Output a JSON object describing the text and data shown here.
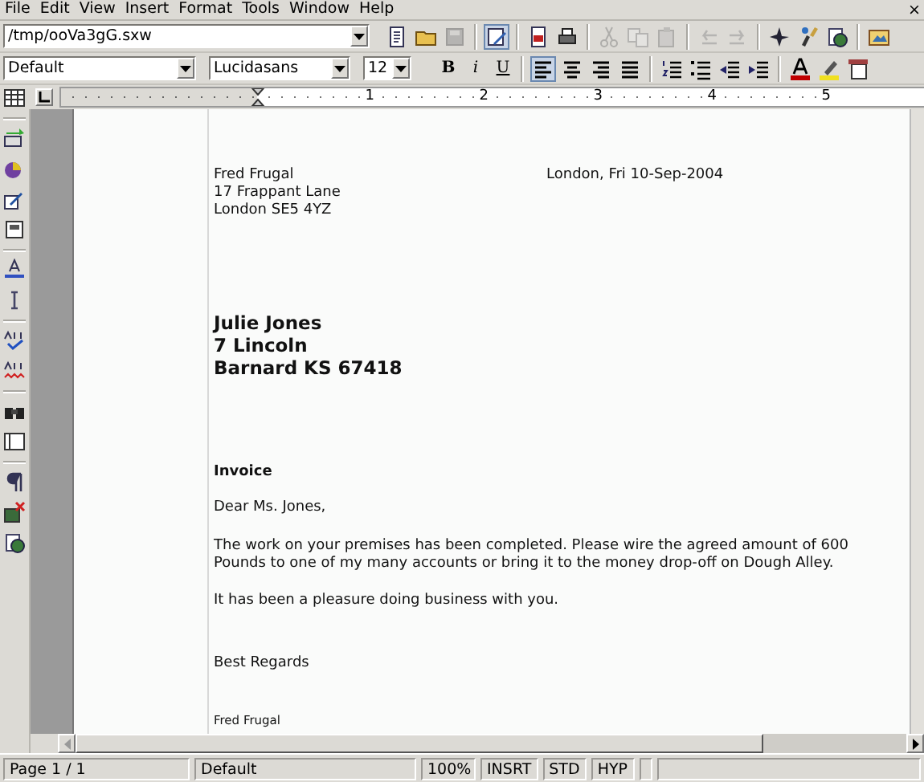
{
  "menu": [
    {
      "label": "File"
    },
    {
      "label": "Edit"
    },
    {
      "label": "View"
    },
    {
      "label": "Insert"
    },
    {
      "label": "Format"
    },
    {
      "label": "Tools"
    },
    {
      "label": "Window"
    },
    {
      "label": "Help"
    }
  ],
  "close_glyph": "×",
  "location_field": {
    "value": "/tmp/ooVa3gG.sxw"
  },
  "standard_toolbar": [
    {
      "kind": "document",
      "pressed": false,
      "disabled": false
    },
    {
      "kind": "folder",
      "pressed": false,
      "disabled": false
    },
    {
      "kind": "disk",
      "pressed": false,
      "disabled": true
    },
    {
      "kind": "sep"
    },
    {
      "kind": "edit",
      "pressed": true,
      "disabled": false
    },
    {
      "kind": "sep"
    },
    {
      "kind": "pdf",
      "pressed": false,
      "disabled": false
    },
    {
      "kind": "printer",
      "pressed": false,
      "disabled": false
    },
    {
      "kind": "sep"
    },
    {
      "kind": "scissors",
      "pressed": false,
      "disabled": true
    },
    {
      "kind": "copy",
      "pressed": false,
      "disabled": true
    },
    {
      "kind": "paste",
      "pressed": false,
      "disabled": true
    },
    {
      "kind": "sep"
    },
    {
      "kind": "undo",
      "pressed": false,
      "disabled": true
    },
    {
      "kind": "redo",
      "pressed": false,
      "disabled": true
    },
    {
      "kind": "sep"
    },
    {
      "kind": "compass",
      "pressed": false,
      "disabled": false
    },
    {
      "kind": "brush",
      "pressed": false,
      "disabled": false
    },
    {
      "kind": "globe",
      "pressed": false,
      "disabled": false
    },
    {
      "kind": "sep"
    },
    {
      "kind": "picture",
      "pressed": false,
      "disabled": false
    }
  ],
  "formatting": {
    "style": "Default",
    "font": "Lucidasans",
    "size": "12",
    "text_buttons": [
      {
        "kind": "bold",
        "label": "B",
        "pressed": false
      },
      {
        "kind": "italic",
        "label": "i",
        "pressed": false
      },
      {
        "kind": "underline",
        "label": "U",
        "pressed": false
      }
    ],
    "icons": [
      {
        "kind": "sep"
      },
      {
        "kind": "align-left",
        "pressed": true
      },
      {
        "kind": "align-center",
        "pressed": false
      },
      {
        "kind": "align-right",
        "pressed": false
      },
      {
        "kind": "justify",
        "pressed": false
      },
      {
        "kind": "sep"
      },
      {
        "kind": "numbered-list",
        "pressed": false
      },
      {
        "kind": "bullet-list",
        "pressed": false
      },
      {
        "kind": "outdent",
        "pressed": false
      },
      {
        "kind": "indent",
        "pressed": false
      },
      {
        "kind": "sep"
      },
      {
        "kind": "font-color",
        "pressed": false
      },
      {
        "kind": "highlight",
        "pressed": false
      },
      {
        "kind": "frame",
        "pressed": false
      }
    ]
  },
  "ruler": {
    "numbers": [
      "1",
      "2",
      "3",
      "4",
      "5"
    ]
  },
  "side_toolbar": [
    {
      "kind": "table"
    },
    {
      "kind": "sep"
    },
    {
      "kind": "fields"
    },
    {
      "kind": "chart"
    },
    {
      "kind": "pen"
    },
    {
      "kind": "form"
    },
    {
      "kind": "sep"
    },
    {
      "kind": "abc-a"
    },
    {
      "kind": "text-cursor"
    },
    {
      "kind": "sep"
    },
    {
      "kind": "spellcheck"
    },
    {
      "kind": "autospell"
    },
    {
      "kind": "sep"
    },
    {
      "kind": "binoculars"
    },
    {
      "kind": "panel"
    },
    {
      "kind": "sep"
    },
    {
      "kind": "pilcrow"
    },
    {
      "kind": "image-cross"
    },
    {
      "kind": "globe"
    }
  ],
  "document": {
    "sender": {
      "name": "Fred Frugal",
      "date": "London, Fri 10-Sep-2004",
      "lines": [
        "17 Frappant Lane",
        "London SE5 4YZ"
      ]
    },
    "recipient": [
      "Julie Jones",
      "7 Lincoln",
      "Barnard KS 67418"
    ],
    "subject": "Invoice",
    "salutation": "Dear Ms. Jones,",
    "body": [
      "The work on your premises has been completed. Please wire the agreed amount of 600 Pounds to one of my many accounts or bring it to the money drop-off on Dough Alley.",
      "It has been a pleasure doing business with you."
    ],
    "closing": "Best Regards",
    "signature": "Fred Frugal"
  },
  "status_bar": [
    {
      "kind": "page",
      "text": "Page 1 / 1"
    },
    {
      "kind": "style",
      "text": "Default"
    },
    {
      "kind": "zoom",
      "text": "100%"
    },
    {
      "kind": "mode",
      "text": "INSRT"
    },
    {
      "kind": "mode",
      "text": "STD"
    },
    {
      "kind": "mode",
      "text": "HYP"
    },
    {
      "kind": "empty"
    },
    {
      "kind": "fill"
    }
  ]
}
